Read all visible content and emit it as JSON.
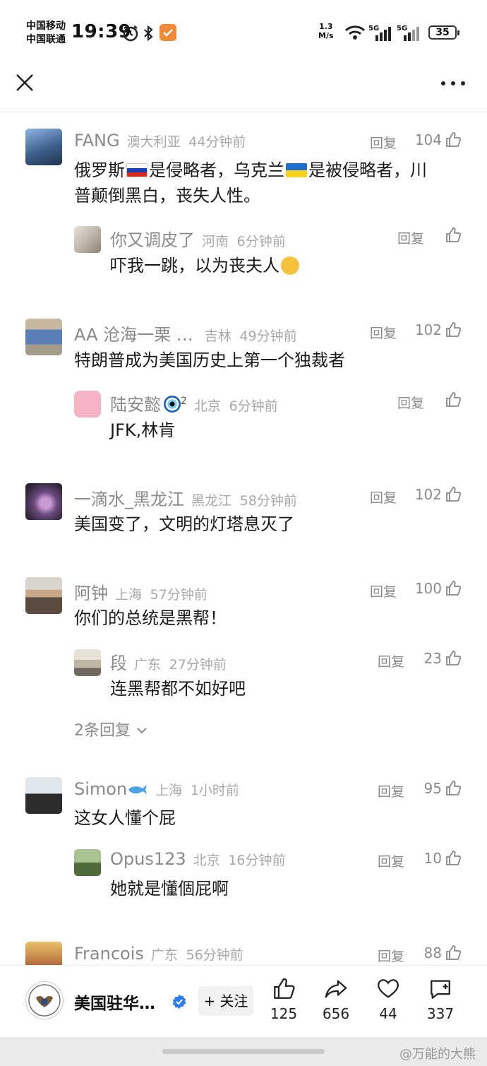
{
  "status_bar": {
    "carrier1": "中国移动",
    "carrier2": "中国联通",
    "time": "19:39",
    "net_speed_value": "1.3",
    "net_speed_unit": "M/s",
    "sig1": "5G",
    "sig2": "5G",
    "battery": "35"
  },
  "comments": [
    {
      "name": "FANG",
      "location": "澳大利亚",
      "time": "44分钟前",
      "reply_label": "回复",
      "likes": "104",
      "text_parts": [
        "俄罗斯",
        "是侵略者，乌克兰",
        "是被侵略者，川"
      ],
      "text_line2": "普颠倒黑白，丧失人性。",
      "replies": [
        {
          "name": "你又调皮了",
          "location": "河南",
          "time": "6分钟前",
          "reply_label": "回复",
          "text": "吓我一跳，以为丧夫人"
        }
      ]
    },
    {
      "name": "AA 沧海一栗 …",
      "location": "吉林",
      "time": "49分钟前",
      "reply_label": "回复",
      "likes": "102",
      "text": "特朗普成为美国历史上第一个独裁者",
      "replies": [
        {
          "name": "陆安懿",
          "badge": "2",
          "location": "北京",
          "time": "6分钟前",
          "reply_label": "回复",
          "text": "JFK,林肯"
        }
      ]
    },
    {
      "name": "一滴水_黑龙江",
      "location": "黑龙江",
      "time": "58分钟前",
      "reply_label": "回复",
      "likes": "102",
      "text": "美国变了，文明的灯塔息灭了"
    },
    {
      "name": "阿钟",
      "location": "上海",
      "time": "57分钟前",
      "reply_label": "回复",
      "likes": "100",
      "text": "你们的总统是黑帮！",
      "replies": [
        {
          "name": "段",
          "location": "广东",
          "time": "27分钟前",
          "reply_label": "回复",
          "likes": "23",
          "text": "连黑帮都不如好吧"
        }
      ],
      "more_replies": "2条回复"
    },
    {
      "name": "Simon",
      "location": "上海",
      "time": "1小时前",
      "reply_label": "回复",
      "likes": "95",
      "text": "这女人懂个屁",
      "replies": [
        {
          "name": "Opus123",
          "location": "北京",
          "time": "16分钟前",
          "reply_label": "回复",
          "likes": "10",
          "text": "她就是懂個屁啊"
        }
      ]
    },
    {
      "name": "Francois",
      "location": "广东",
      "time": "56分钟前",
      "reply_label": "回复",
      "likes": "88"
    }
  ],
  "bottom_bar": {
    "account_name": "美国驻华…",
    "follow_label": "+ 关注",
    "like_count": "125",
    "share_count": "656",
    "favorite_count": "44",
    "comment_count": "337"
  },
  "watermark": "@万能的大熊",
  "icons": [
    "close-icon",
    "more-icon",
    "thumb-up-icon",
    "share-icon",
    "heart-icon",
    "comment-icon",
    "verified-icon",
    "chevron-down-icon"
  ]
}
